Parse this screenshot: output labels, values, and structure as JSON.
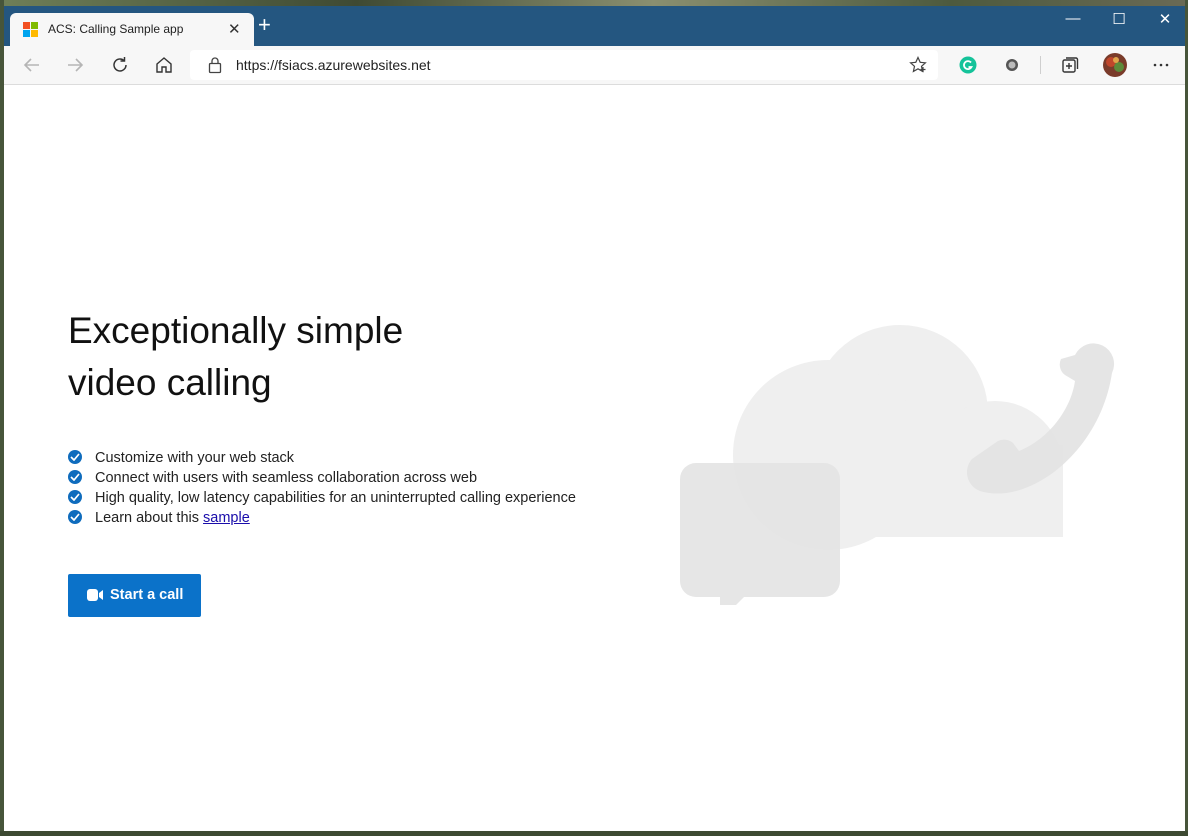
{
  "browser": {
    "tab_title": "ACS: Calling Sample app",
    "tab_close": "✕",
    "new_tab": "+",
    "url": "https://fsiacs.azurewebsites.net",
    "window_controls": {
      "minimize": "—",
      "maximize": "☐",
      "close": "✕"
    },
    "icons": [
      "back-arrow-icon",
      "forward-arrow-icon",
      "refresh-icon",
      "home-icon",
      "lock-icon",
      "favorite-star-icon",
      "grammarly-extension-icon",
      "extension-icon",
      "collections-icon",
      "profile-avatar",
      "more-menu-icon"
    ]
  },
  "page": {
    "headline_line1": "Exceptionally simple",
    "headline_line2": "video calling",
    "features": [
      "Customize with your web stack",
      "Connect with users with seamless collaboration across web",
      "High quality, low latency capabilities for an uninterrupted calling experience"
    ],
    "learn_prefix": "Learn about this ",
    "learn_link": "sample",
    "start_button": "Start a call"
  },
  "colors": {
    "titlebar": "#245680",
    "accent": "#0b72c9",
    "check": "#0f6cbd",
    "grammarly": "#15c39a"
  }
}
